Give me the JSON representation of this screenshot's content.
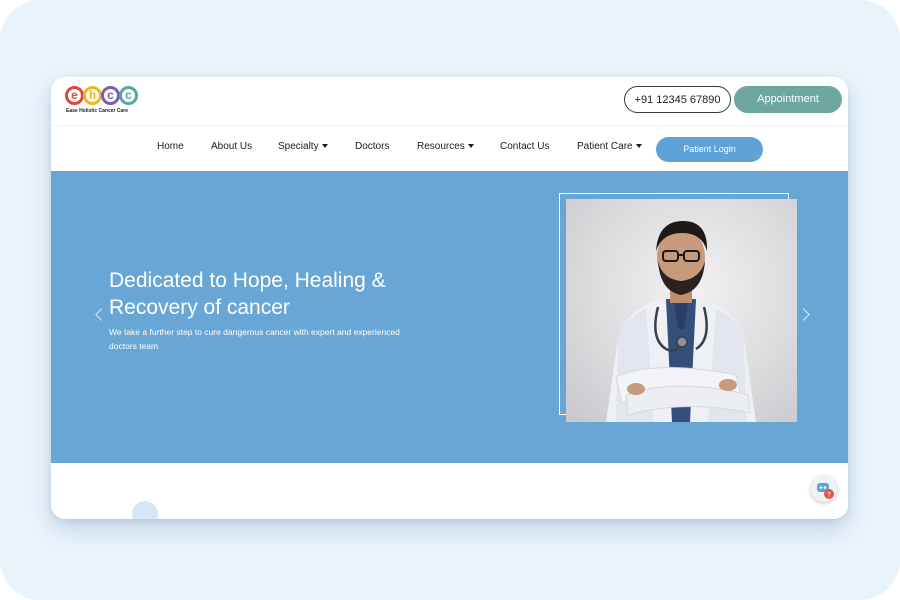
{
  "brand": {
    "letters": [
      "e",
      "h",
      "c",
      "c"
    ],
    "letter_colors": [
      "#e0453f",
      "#f1b52b",
      "#7c5cb0",
      "#57a7a0"
    ],
    "tagline": "Ease Holistic Cancer Care"
  },
  "header": {
    "phone": "+91 12345 67890",
    "appointment_label": "Appointment"
  },
  "nav": {
    "items": [
      {
        "label": "Home",
        "dropdown": false
      },
      {
        "label": "About Us",
        "dropdown": false
      },
      {
        "label": "Specialty",
        "dropdown": true
      },
      {
        "label": "Doctors",
        "dropdown": false
      },
      {
        "label": "Resources",
        "dropdown": true
      },
      {
        "label": "Contact Us",
        "dropdown": false
      },
      {
        "label": "Patient Care",
        "dropdown": true
      }
    ],
    "login_label": "Patient Login"
  },
  "hero": {
    "title_line1": "Dedicated to Hope, Healing &",
    "title_line2": "Recovery of cancer",
    "subtitle": "We take a further step to cure dangerous cancer with expert and experienced doctors team",
    "background": "#68a6d6",
    "image_icon": "doctor-portrait"
  },
  "colors": {
    "accent_blue": "#5fa2d8",
    "accent_teal": "#6ea6a0",
    "page_background": "#e9f3fb"
  },
  "widgets": {
    "chat_icon": "chat-bot-icon"
  }
}
